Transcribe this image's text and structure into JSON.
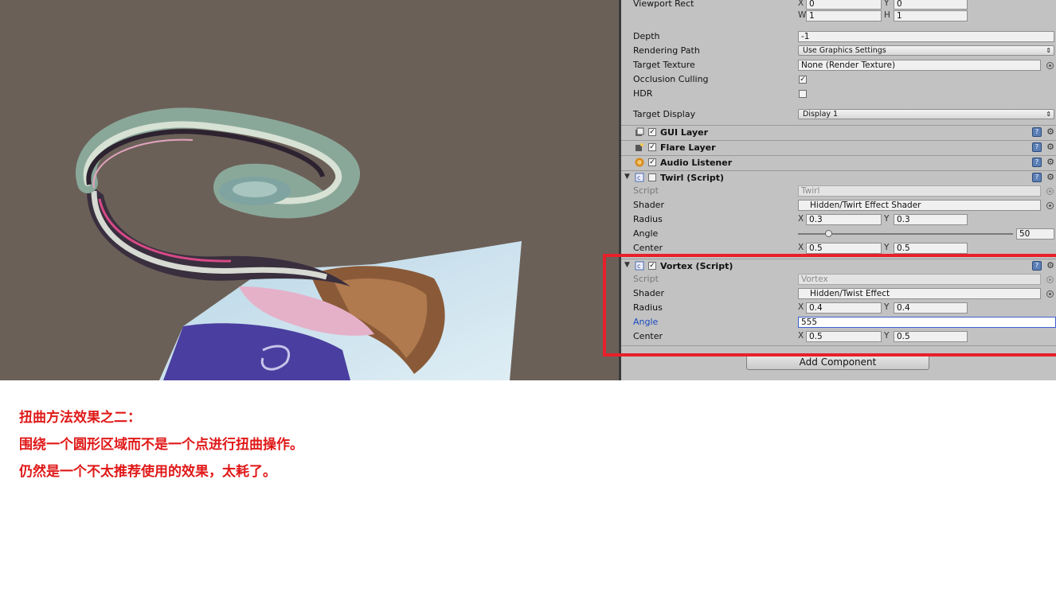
{
  "camera": {
    "viewport_rect": {
      "label": "Viewport Rect",
      "x": "0",
      "y": "0",
      "w": "1",
      "h": "1"
    },
    "depth": {
      "label": "Depth",
      "value": "-1"
    },
    "rendering_path": {
      "label": "Rendering Path",
      "value": "Use Graphics Settings"
    },
    "target_texture": {
      "label": "Target Texture",
      "value": "None (Render Texture)"
    },
    "occlusion_culling": {
      "label": "Occlusion Culling",
      "checked": true
    },
    "hdr": {
      "label": "HDR",
      "checked": false
    },
    "target_display": {
      "label": "Target Display",
      "value": "Display 1"
    }
  },
  "components": {
    "gui_layer": {
      "title": "GUI Layer",
      "enabled": true
    },
    "flare_layer": {
      "title": "Flare Layer",
      "enabled": true
    },
    "audio_listener": {
      "title": "Audio Listener",
      "enabled": true
    },
    "twirl": {
      "title": "Twirl (Script)",
      "enabled": false,
      "script_label": "Script",
      "script": "Twirl",
      "shader_label": "Shader",
      "shader": "Hidden/Twirt Effect Shader",
      "radius_label": "Radius",
      "radius_x": "0.3",
      "radius_y": "0.3",
      "angle_label": "Angle",
      "angle": "50",
      "angle_fraction": 0.14,
      "center_label": "Center",
      "center_x": "0.5",
      "center_y": "0.5"
    },
    "vortex": {
      "title": "Vortex (Script)",
      "enabled": true,
      "script_label": "Script",
      "script": "Vortex",
      "shader_label": "Shader",
      "shader": "Hidden/Twist Effect",
      "radius_label": "Radius",
      "radius_x": "0.4",
      "radius_y": "0.4",
      "angle_label": "Angle",
      "angle": "555",
      "center_label": "Center",
      "center_x": "0.5",
      "center_y": "0.5"
    }
  },
  "axis": {
    "x": "X",
    "y": "Y",
    "w": "W",
    "h": "H"
  },
  "add_component": "Add Component",
  "caption": {
    "line1": "扭曲方法效果之二：",
    "line2": "围绕一个圆形区域而不是一个点进行扭曲操作。",
    "line3": "仍然是一个不太推荐使用的效果，太耗了。"
  },
  "colors": {
    "highlight": "#e8202a",
    "caption": "#e01818",
    "inspector_bg": "#c2c2c2"
  }
}
